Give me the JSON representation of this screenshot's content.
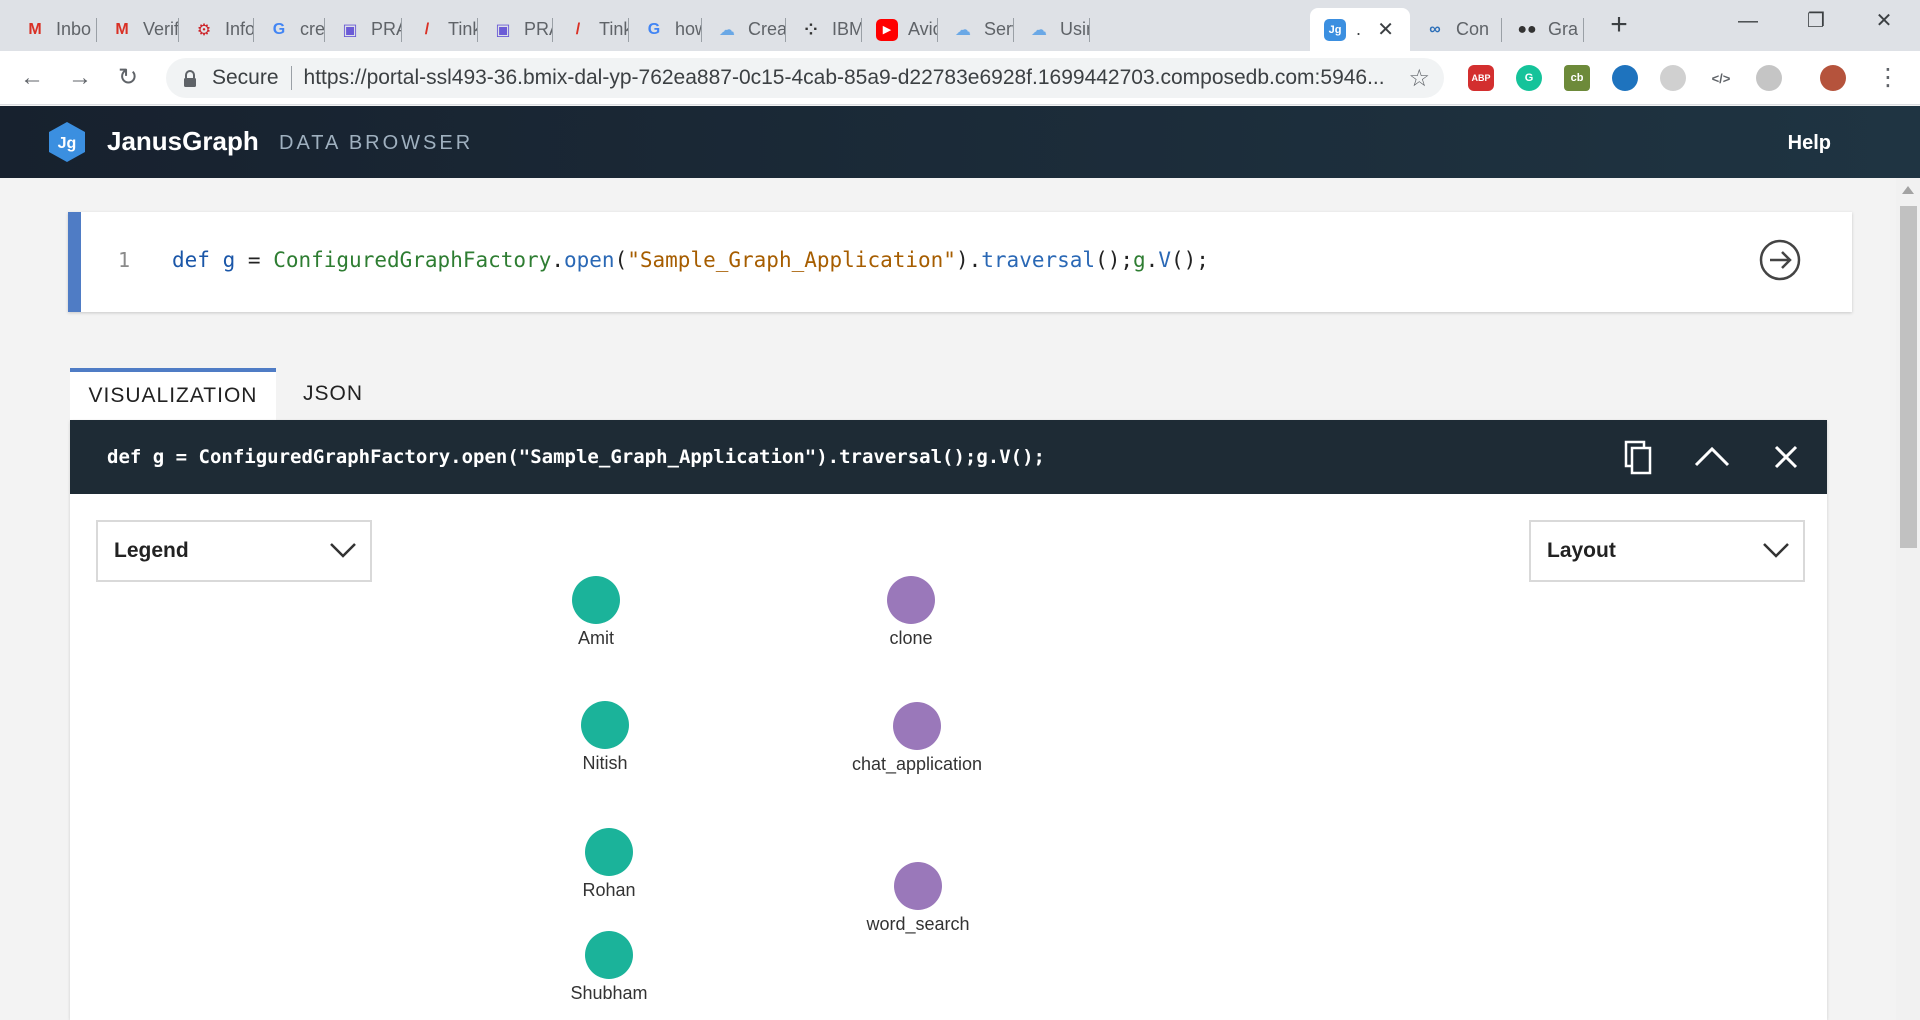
{
  "browser": {
    "tabs": [
      {
        "title": "Inbo",
        "icon": "gmail-icon"
      },
      {
        "title": "Verif",
        "icon": "gmail-icon"
      },
      {
        "title": "Info",
        "icon": "sync-wheel-icon"
      },
      {
        "title": "crea",
        "icon": "google-icon"
      },
      {
        "title": "PRA",
        "icon": "square-target-icon"
      },
      {
        "title": "Tink",
        "icon": "pencil-icon"
      },
      {
        "title": "PRA",
        "icon": "square-target-icon"
      },
      {
        "title": "Tink",
        "icon": "pencil-icon"
      },
      {
        "title": "how",
        "icon": "google-icon"
      },
      {
        "title": "Crea",
        "icon": "cloud-icon"
      },
      {
        "title": "IBM",
        "icon": "bicycle-icon"
      },
      {
        "title": "Avic",
        "icon": "youtube-icon"
      },
      {
        "title": "Serv",
        "icon": "cloud-icon"
      },
      {
        "title": "Usin",
        "icon": "cloud-icon"
      },
      {
        "title": ".",
        "icon": "janusgraph-icon",
        "active": true
      },
      {
        "title": "Con",
        "icon": "chain-icon"
      },
      {
        "title": "Gra",
        "icon": "glasses-icon"
      }
    ],
    "secure_label": "Secure",
    "url": "https://portal-ssl493-36.bmix-dal-yp-762ea887-0c15-4cab-85a9-d22783e6928f.1699442703.composedb.com:5946...",
    "extensions": [
      {
        "name": "adblock-icon",
        "text": "ABP",
        "color": "#d32f2f"
      },
      {
        "name": "grammarly-icon",
        "text": "G",
        "color": "#15c39a"
      },
      {
        "name": "cb-extension-icon",
        "text": "cb",
        "color": "#6d8a3a"
      },
      {
        "name": "transit-extension-icon",
        "text": "",
        "color": "#1e73be"
      },
      {
        "name": "grey-extension-icon",
        "text": "",
        "color": "#d0d0d0"
      },
      {
        "name": "code-extension-icon",
        "text": "</>",
        "color": "#ffffff"
      },
      {
        "name": "puzzle-extension-icon",
        "text": "",
        "color": "#c5c5c5"
      },
      {
        "name": "profile-avatar",
        "text": "",
        "color": "#b5533c"
      }
    ]
  },
  "app": {
    "logo_text": "Jg",
    "brand": "JanusGraph",
    "subtitle": "DATA BROWSER",
    "help": "Help"
  },
  "editor": {
    "line_number": "1",
    "code_tokens": [
      {
        "t": "def",
        "c": "k-kw"
      },
      {
        "t": " ",
        "c": "k-plain"
      },
      {
        "t": "g",
        "c": "k-var"
      },
      {
        "t": " = ",
        "c": "k-plain"
      },
      {
        "t": "ConfiguredGraphFactory",
        "c": "k-cls"
      },
      {
        "t": ".",
        "c": "k-plain"
      },
      {
        "t": "open",
        "c": "k-fn"
      },
      {
        "t": "(",
        "c": "k-plain"
      },
      {
        "t": "\"Sample_Graph_Application\"",
        "c": "k-str"
      },
      {
        "t": ").",
        "c": "k-plain"
      },
      {
        "t": "traversal",
        "c": "k-fn"
      },
      {
        "t": "();",
        "c": "k-plain"
      },
      {
        "t": "g",
        "c": "k-cls"
      },
      {
        "t": ".",
        "c": "k-plain"
      },
      {
        "t": "V",
        "c": "k-fn"
      },
      {
        "t": "();",
        "c": "k-plain"
      }
    ]
  },
  "result": {
    "tabs": [
      "VISUALIZATION",
      "JSON"
    ],
    "query": "def g = ConfiguredGraphFactory.open(\"Sample_Graph_Application\").traversal();g.V();",
    "legend_label": "Legend",
    "layout_label": "Layout",
    "colors": {
      "person": "#1bb39a",
      "application": "#9a78ba"
    },
    "nodes": [
      {
        "label": "Amit",
        "group": "person"
      },
      {
        "label": "Nitish",
        "group": "person"
      },
      {
        "label": "Rohan",
        "group": "person"
      },
      {
        "label": "Shubham",
        "group": "person"
      },
      {
        "label": "clone",
        "group": "application"
      },
      {
        "label": "chat_application",
        "group": "application"
      },
      {
        "label": "word_search",
        "group": "application"
      }
    ]
  }
}
